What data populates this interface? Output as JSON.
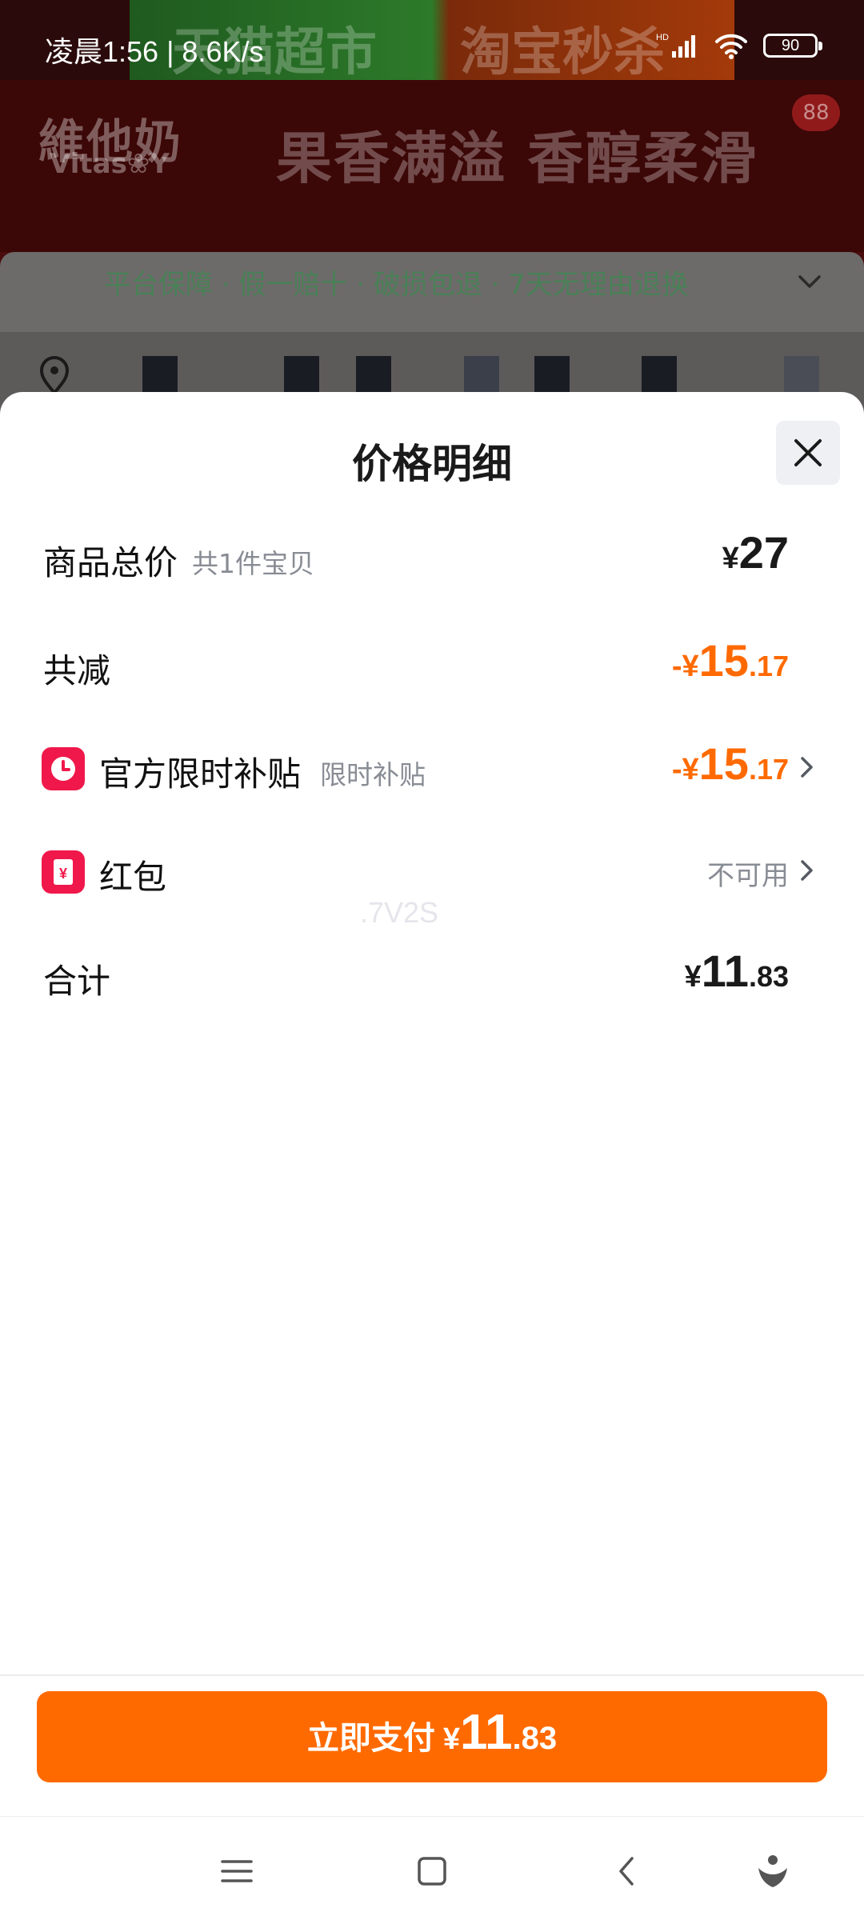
{
  "status_bar": {
    "time_speed": "凌晨1:56 | 8.6K/s",
    "network": "HD",
    "battery": "90"
  },
  "background_page": {
    "top_banner_left": "天猫超市",
    "top_banner_right": "淘宝秒杀",
    "brand": "維他奶",
    "brand_sub": "Vitas❀Y",
    "slogan": "果香满溢 香醇柔滑",
    "cart_count": "88",
    "guarantee": "平台保障 · 假一赔十 · 破损包退 · 7天无理由退换"
  },
  "sheet": {
    "title": "价格明细",
    "rows": [
      {
        "label": "商品总价",
        "sub": "共1件宝贝",
        "amount": {
          "symbol": "¥",
          "int": "27",
          "dec": ""
        }
      },
      {
        "label": "共减",
        "amount": {
          "symbol": "-¥",
          "int": "15",
          "dec": ".17"
        }
      },
      {
        "label": "官方限时补贴",
        "sub": "限时补贴",
        "amount": {
          "symbol": "-¥",
          "int": "15",
          "dec": ".17"
        }
      },
      {
        "label": "红包",
        "status": "不可用"
      },
      {
        "label": "合计",
        "amount": {
          "symbol": "¥",
          "int": "11",
          "dec": ".83"
        }
      }
    ],
    "watermark": ".7V2S"
  },
  "footer": {
    "pay_label": "立即支付",
    "pay_symbol": "¥",
    "pay_int": "11",
    "pay_dec": ".83"
  },
  "colors": {
    "accent": "#ff6a00",
    "icon_red": "#f0184a",
    "muted": "#888c94"
  },
  "icons": [
    "clock-icon",
    "red-packet-icon",
    "close-icon",
    "chevron-right-icon",
    "menu-icon",
    "home-icon",
    "back-icon",
    "assistant-icon"
  ]
}
